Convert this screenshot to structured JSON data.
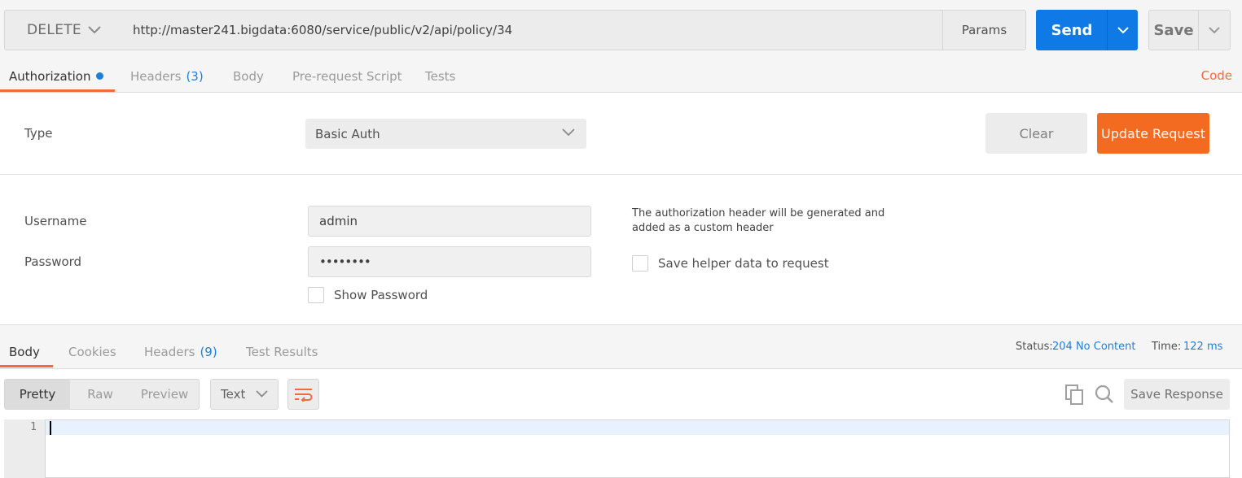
{
  "request": {
    "method": "DELETE",
    "url": "http://master241.bigdata:6080/service/public/v2/api/policy/34",
    "params_label": "Params",
    "send_label": "Send",
    "save_label": "Save"
  },
  "request_tabs": {
    "authorization": "Authorization",
    "headers": "Headers",
    "headers_count": "(3)",
    "body": "Body",
    "pre_request": "Pre-request Script",
    "tests": "Tests",
    "code": "Code"
  },
  "auth": {
    "type_label": "Type",
    "type_value": "Basic Auth",
    "clear_label": "Clear",
    "update_label": "Update Request",
    "username_label": "Username",
    "username_value": "admin",
    "password_label": "Password",
    "password_value": "••••••••",
    "show_password_label": "Show Password",
    "note": "The authorization header will be generated and added as a custom header",
    "save_helper_label": "Save helper data to request"
  },
  "response_tabs": {
    "body": "Body",
    "cookies": "Cookies",
    "headers": "Headers",
    "headers_count": "(9)",
    "test_results": "Test Results"
  },
  "response_status": {
    "status_label": "Status:",
    "status_value": "204 No Content",
    "time_label": "Time:",
    "time_value": "122 ms"
  },
  "response_view": {
    "pretty": "Pretty",
    "raw": "Raw",
    "preview": "Preview",
    "format": "Text",
    "save_response": "Save Response"
  },
  "editor": {
    "line_number": "1"
  },
  "colors": {
    "send_blue": "#0f7ae5",
    "accent_orange": "#f26b3a",
    "update_orange": "#f26b21",
    "link_blue": "#1f7fd8"
  }
}
